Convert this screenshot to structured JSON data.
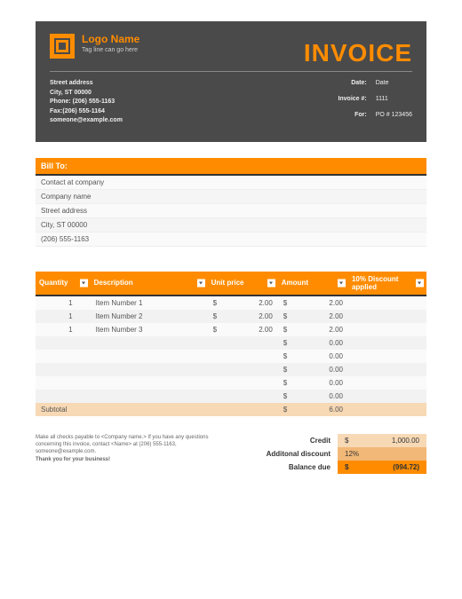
{
  "header": {
    "logo_name": "Logo\nName",
    "tagline": "Tag line can go here",
    "title": "INVOICE",
    "company": {
      "street": "Street address",
      "city": "City, ST  00000",
      "phone": "Phone: (206) 555-1163",
      "fax": "Fax:(206) 555-1164",
      "email": "someone@example.com"
    },
    "meta": {
      "date_label": "Date:",
      "date_value": "Date",
      "invoice_label": "Invoice #:",
      "invoice_value": "1111",
      "for_label": "For:",
      "for_value": "PO # 123456"
    }
  },
  "bill_to": {
    "header": "Bill To:",
    "lines": [
      "Contact at company",
      "Company name",
      "Street address",
      "City, ST  00000",
      "(206) 555-1163"
    ]
  },
  "items": {
    "columns": [
      "Quantity",
      "Description",
      "Unit price",
      "Amount",
      "10% Discount applied"
    ],
    "rows": [
      {
        "qty": "1",
        "desc": "Item Number 1",
        "price": "2.00",
        "amount": "2.00",
        "disc": ""
      },
      {
        "qty": "1",
        "desc": "Item Number 2",
        "price": "2.00",
        "amount": "2.00",
        "disc": ""
      },
      {
        "qty": "1",
        "desc": "Item Number 3",
        "price": "2.00",
        "amount": "2.00",
        "disc": ""
      },
      {
        "qty": "",
        "desc": "",
        "price": "",
        "amount": "0.00",
        "disc": ""
      },
      {
        "qty": "",
        "desc": "",
        "price": "",
        "amount": "0.00",
        "disc": ""
      },
      {
        "qty": "",
        "desc": "",
        "price": "",
        "amount": "0.00",
        "disc": ""
      },
      {
        "qty": "",
        "desc": "",
        "price": "",
        "amount": "0.00",
        "disc": ""
      },
      {
        "qty": "",
        "desc": "",
        "price": "",
        "amount": "0.00",
        "disc": ""
      }
    ],
    "subtotal_label": "Subtotal",
    "subtotal_value": "6.00"
  },
  "footer": {
    "note": "Make all checks payable to <Company name.> If you have any questions concerning this invoice, contact <Name> at (206) 555-1163, someone@example.com.",
    "thanks": "Thank you for your business!"
  },
  "totals": {
    "credit_label": "Credit",
    "credit_value": "1,000.00",
    "discount_label": "Additonal discount",
    "discount_value": "12%",
    "balance_label": "Balance due",
    "balance_value": "(994.72)"
  },
  "currency": "$"
}
